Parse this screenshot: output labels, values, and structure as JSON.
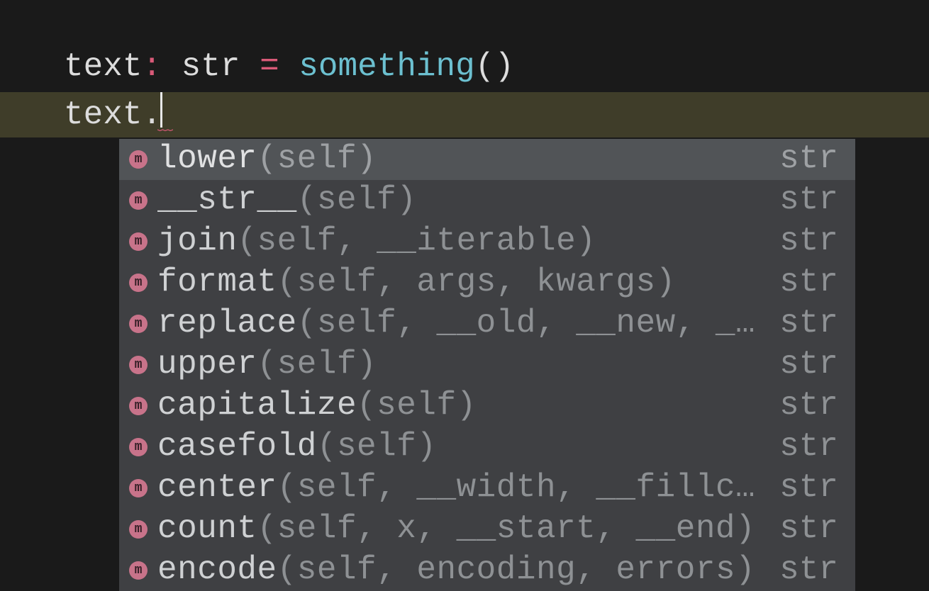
{
  "code": {
    "line1": {
      "ident": "text",
      "colon": ":",
      "space1": " ",
      "type": "str",
      "space2": " ",
      "op": "=",
      "space3": " ",
      "func": "something",
      "parens": "()"
    },
    "line2": {
      "ident": "text",
      "dot": "."
    }
  },
  "completion": {
    "kind_letter": "m",
    "items": [
      {
        "name": "lower",
        "params": "(self)",
        "ret": "str",
        "selected": true
      },
      {
        "name": "__str__",
        "params": "(self)",
        "ret": "str",
        "selected": false
      },
      {
        "name": "join",
        "params": "(self, __iterable)",
        "ret": "str",
        "selected": false
      },
      {
        "name": "format",
        "params": "(self, args, kwargs)",
        "ret": "str",
        "selected": false
      },
      {
        "name": "replace",
        "params": "(self, __old, __new, __c…",
        "ret": "str",
        "selected": false
      },
      {
        "name": "upper",
        "params": "(self)",
        "ret": "str",
        "selected": false
      },
      {
        "name": "capitalize",
        "params": "(self)",
        "ret": "str",
        "selected": false
      },
      {
        "name": "casefold",
        "params": "(self)",
        "ret": "str",
        "selected": false
      },
      {
        "name": "center",
        "params": "(self, __width, __fillcha…",
        "ret": "str",
        "selected": false
      },
      {
        "name": "count",
        "params": "(self, x, __start, __end)",
        "ret": "str",
        "selected": false
      },
      {
        "name": "encode",
        "params": "(self, encoding, errors)",
        "ret": "str",
        "selected": false
      }
    ]
  }
}
